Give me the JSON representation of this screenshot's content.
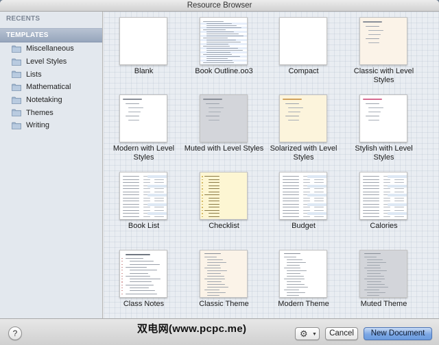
{
  "window": {
    "title": "Resource Browser"
  },
  "sidebar": {
    "recents_label": "RECENTS",
    "templates_label": "TEMPLATES",
    "items": [
      {
        "label": "Miscellaneous",
        "name": "sidebar-item-miscellaneous"
      },
      {
        "label": "Level Styles",
        "name": "sidebar-item-level-styles"
      },
      {
        "label": "Lists",
        "name": "sidebar-item-lists"
      },
      {
        "label": "Mathematical",
        "name": "sidebar-item-mathematical"
      },
      {
        "label": "Notetaking",
        "name": "sidebar-item-notetaking"
      },
      {
        "label": "Themes",
        "name": "sidebar-item-themes"
      },
      {
        "label": "Writing",
        "name": "sidebar-item-writing"
      }
    ]
  },
  "templates": [
    {
      "label": "Blank",
      "bg": "#ffffff",
      "style": "blank"
    },
    {
      "label": "Book Outline.oo3",
      "bg": "#ffffff",
      "style": "outline"
    },
    {
      "label": "Compact",
      "bg": "#ffffff",
      "style": "blank"
    },
    {
      "label": "Classic with Level Styles",
      "bg": "#fbf3e8",
      "style": "level"
    },
    {
      "label": "Modern with Level Styles",
      "bg": "#ffffff",
      "style": "level"
    },
    {
      "label": "Muted with Level Styles",
      "bg": "#d3d5da",
      "style": "level"
    },
    {
      "label": "Solarized with Level Styles",
      "bg": "#fcf4dc",
      "style": "level-solar"
    },
    {
      "label": "Stylish with Level Styles",
      "bg": "#ffffff",
      "style": "level-pink"
    },
    {
      "label": "Book List",
      "bg": "#ffffff",
      "style": "table"
    },
    {
      "label": "Checklist",
      "bg": "#fdf6d3",
      "style": "checklist"
    },
    {
      "label": "Budget",
      "bg": "#ffffff",
      "style": "table"
    },
    {
      "label": "Calories",
      "bg": "#ffffff",
      "style": "table"
    },
    {
      "label": "Class Notes",
      "bg": "#ffffff",
      "style": "notes"
    },
    {
      "label": "Classic Theme",
      "bg": "#fbf3e8",
      "style": "theme"
    },
    {
      "label": "Modern Theme",
      "bg": "#ffffff",
      "style": "theme"
    },
    {
      "label": "Muted Theme",
      "bg": "#d3d5da",
      "style": "theme"
    }
  ],
  "bottombar": {
    "help_label": "?",
    "gear_label": "⚙",
    "gear_caret": "▼",
    "cancel_label": "Cancel",
    "new_document_label": "New Document"
  },
  "watermark": {
    "text": "双电网(www.pcpc.me)"
  }
}
